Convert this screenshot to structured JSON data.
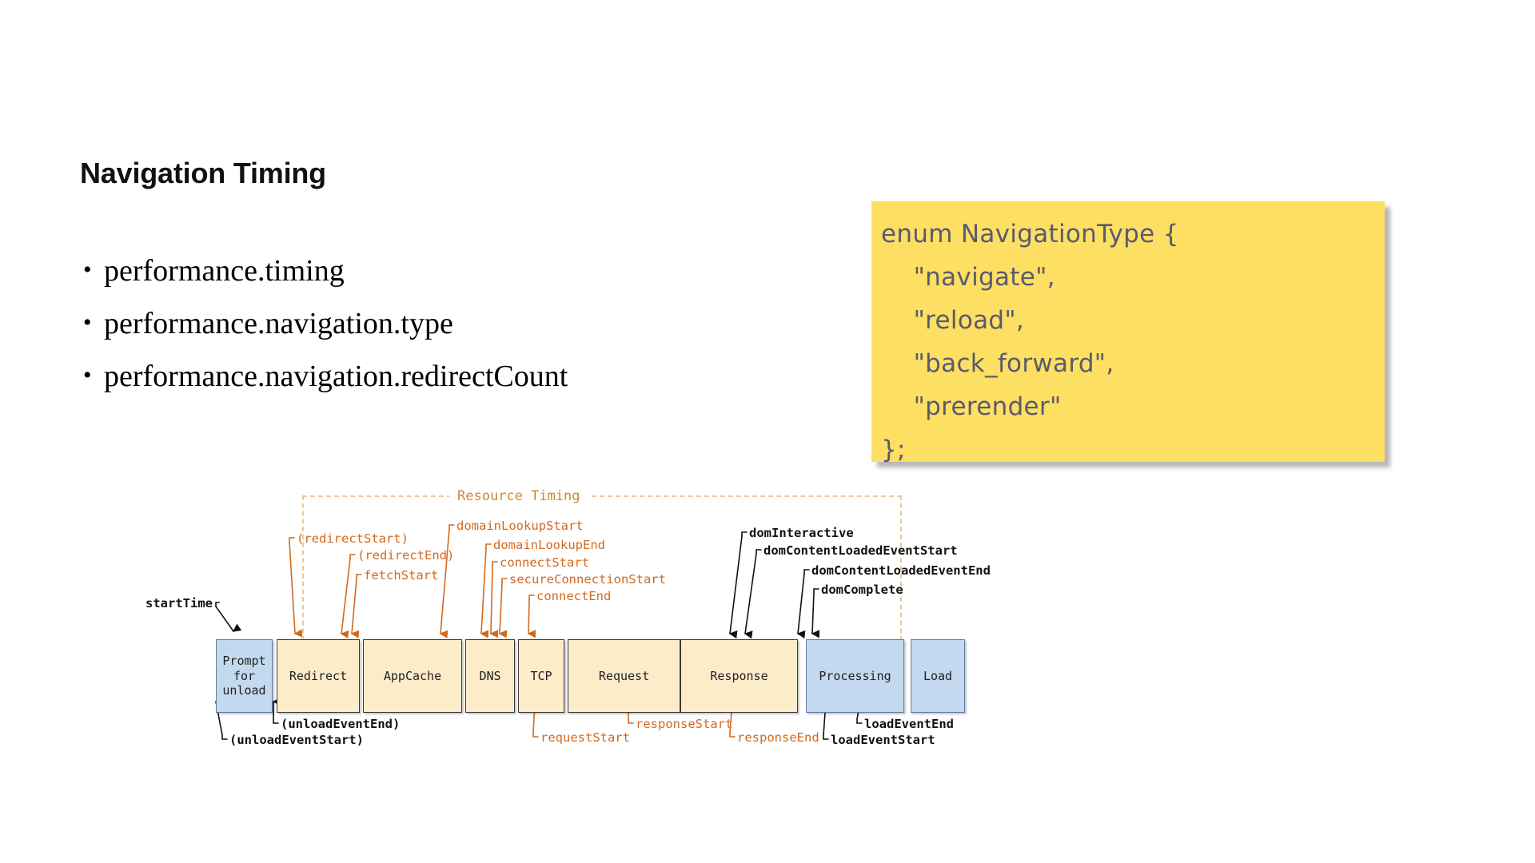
{
  "slide": {
    "title": "Navigation Timing",
    "bullets": [
      "performance.timing",
      "performance.navigation.type",
      "performance.navigation.redirectCount"
    ],
    "bullet_marker": "•"
  },
  "code_note": {
    "background_color": "#fcdf63",
    "text_color": "#5a5a6e",
    "lines": [
      "enum NavigationType {",
      "    \"navigate\",",
      "    \"reload\",",
      "    \"back_forward\",",
      "    \"prerender\"",
      "};"
    ]
  },
  "diagram": {
    "resource_timing_label": "Resource Timing",
    "accent_orange": "#d2691e",
    "accent_black": "#111111",
    "phases": [
      {
        "label": "Prompt\nfor\nunload",
        "color": "blue"
      },
      {
        "label": "Redirect",
        "color": "cream"
      },
      {
        "label": "AppCache",
        "color": "cream"
      },
      {
        "label": "DNS",
        "color": "cream"
      },
      {
        "label": "TCP",
        "color": "cream"
      },
      {
        "label": "Request",
        "color": "cream"
      },
      {
        "label": "Response",
        "color": "cream"
      },
      {
        "label": "Processing",
        "color": "blue"
      },
      {
        "label": "Load",
        "color": "blue"
      }
    ],
    "labels_top": [
      {
        "text": "startTime",
        "color": "black"
      },
      {
        "text": "(redirectStart)",
        "color": "orange"
      },
      {
        "text": "(redirectEnd)",
        "color": "orange"
      },
      {
        "text": "fetchStart",
        "color": "orange"
      },
      {
        "text": "domainLookupStart",
        "color": "orange"
      },
      {
        "text": "domainLookupEnd",
        "color": "orange"
      },
      {
        "text": "connectStart",
        "color": "orange"
      },
      {
        "text": "secureConnectionStart",
        "color": "orange"
      },
      {
        "text": "connectEnd",
        "color": "orange"
      },
      {
        "text": "domInteractive",
        "color": "black"
      },
      {
        "text": "domContentLoadedEventStart",
        "color": "black"
      },
      {
        "text": "domContentLoadedEventEnd",
        "color": "black"
      },
      {
        "text": "domComplete",
        "color": "black"
      }
    ],
    "labels_bottom": [
      {
        "text": "(unloadEventStart)",
        "color": "black"
      },
      {
        "text": "(unloadEventEnd)",
        "color": "black"
      },
      {
        "text": "requestStart",
        "color": "orange"
      },
      {
        "text": "responseStart",
        "color": "orange"
      },
      {
        "text": "responseEnd",
        "color": "orange"
      },
      {
        "text": "loadEventStart",
        "color": "black"
      },
      {
        "text": "loadEventEnd",
        "color": "black"
      }
    ]
  }
}
